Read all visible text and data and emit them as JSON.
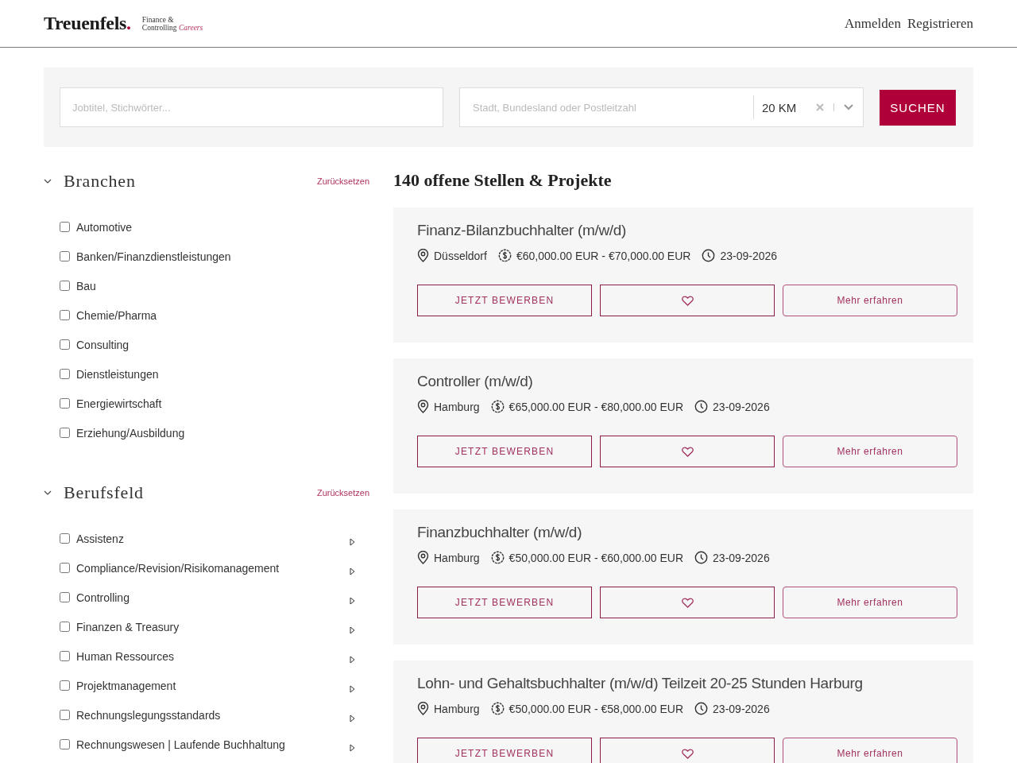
{
  "header": {
    "logo": {
      "name": "Treuenfels",
      "dot": ".",
      "tagline_1": "Finance &",
      "tagline_2": "Controlling",
      "tagline_accent": "Careers"
    },
    "nav": [
      "Anmelden",
      "Registrieren"
    ]
  },
  "search": {
    "keyword_placeholder": "Jobtitel, Stichwörter...",
    "location_placeholder": "Stadt, Bundesland oder Postleitzahl",
    "radius": "20 KM",
    "button": "SUCHEN"
  },
  "filters": [
    {
      "title": "Branchen",
      "reset": "Zurücksetzen",
      "expanded": true,
      "items": [
        {
          "label": "Automotive",
          "checked": false,
          "has_children": false
        },
        {
          "label": "Banken/Finanzdienstleistungen",
          "checked": false,
          "has_children": false
        },
        {
          "label": "Bau",
          "checked": false,
          "has_children": false
        },
        {
          "label": "Chemie/Pharma",
          "checked": false,
          "has_children": false
        },
        {
          "label": "Consulting",
          "checked": false,
          "has_children": false
        },
        {
          "label": "Dienstleistungen",
          "checked": false,
          "has_children": false
        },
        {
          "label": "Energiewirtschaft",
          "checked": false,
          "has_children": false
        },
        {
          "label": "Erziehung/Ausbildung",
          "checked": false,
          "has_children": false
        }
      ]
    },
    {
      "title": "Berufsfeld",
      "reset": "Zurücksetzen",
      "expanded": true,
      "items": [
        {
          "label": "Assistenz",
          "checked": false,
          "has_children": true
        },
        {
          "label": "Compliance/Revision/Risikomanagement",
          "checked": false,
          "has_children": true
        },
        {
          "label": "Controlling",
          "checked": false,
          "has_children": true
        },
        {
          "label": "Finanzen & Treasury",
          "checked": false,
          "has_children": true
        },
        {
          "label": "Human Ressources",
          "checked": false,
          "has_children": true
        },
        {
          "label": "Projektmanagement",
          "checked": false,
          "has_children": true
        },
        {
          "label": "Rechnungslegungsstandards",
          "checked": false,
          "has_children": true
        },
        {
          "label": "Rechnungswesen | Laufende Buchhaltung",
          "checked": false,
          "has_children": true
        }
      ]
    }
  ],
  "results_title": "140 offene Stellen & Projekte",
  "jobs": [
    {
      "title": "Finanz-Bilanzbuchhalter (m/w/d)",
      "location": "Düsseldorf",
      "salary": "€60,000.00 EUR - €70,000.00 EUR",
      "date": "23-09-2026",
      "apply": "JETZT BEWERBEN",
      "more": "Mehr erfahren"
    },
    {
      "title": "Controller (m/w/d)",
      "location": "Hamburg",
      "salary": "€65,000.00 EUR - €80,000.00 EUR",
      "date": "23-09-2026",
      "apply": "JETZT BEWERBEN",
      "more": "Mehr erfahren"
    },
    {
      "title": "Finanzbuchhalter (m/w/d)",
      "location": "Hamburg",
      "salary": "€50,000.00 EUR - €60,000.00 EUR",
      "date": "23-09-2026",
      "apply": "JETZT BEWERBEN",
      "more": "Mehr erfahren"
    },
    {
      "title": "Lohn- und Gehaltsbuchhalter (m/w/d) Teilzeit 20-25 Stunden Harburg",
      "location": "Hamburg",
      "salary": "€50,000.00 EUR - €58,000.00 EUR",
      "date": "23-09-2026",
      "apply": "JETZT BEWERBEN",
      "more": "Mehr erfahren"
    }
  ]
}
